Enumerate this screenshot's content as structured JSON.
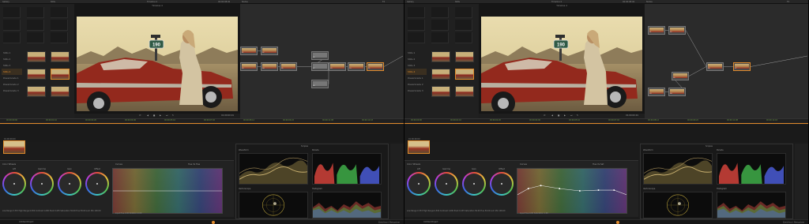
{
  "panes": [
    {
      "id": "left",
      "topbar": {
        "gallery": "Gallery",
        "stills": "Stills",
        "timeline": "Timeline 4",
        "timecode": "00:00:08:00",
        "nodes": "Nodes",
        "fx": "FX"
      },
      "albums": [
        "Stills 1",
        "Stills 2",
        "Stills 3",
        "Stills 4",
        "PowerGrade 1",
        "PowerGrade 2",
        "PowerGrade 3"
      ],
      "viewer": {
        "title": "Timeline 4",
        "timecode": "01:00:00:01",
        "sign": "190"
      },
      "nodes": [
        {
          "label": "01"
        },
        {
          "label": "02"
        },
        {
          "label": "03"
        },
        {
          "label": "04"
        },
        {
          "label": "05"
        },
        {
          "label": "06"
        },
        {
          "label": "07"
        },
        {
          "label": "08"
        },
        {
          "label": "09"
        },
        {
          "label": "10"
        },
        {
          "label": "11"
        }
      ],
      "timeline_marks": [
        "00:00:00:00",
        "00:00:01:10",
        "00:00:02:20",
        "00:00:04:06",
        "00:00:05:16",
        "00:00:07:02",
        "00:00:08:12",
        "00:00:09:22",
        "00:00:11:08",
        "00:00:12:18"
      ],
      "clip": {
        "timecode": "01:00:00:00"
      },
      "color": {
        "title": "Color Wheels",
        "wheels": [
          "Lift",
          "Gamma",
          "Gain",
          "Offset"
        ],
        "values": "Low Range 0.333   High Range 0.500   Contrast 1.000   Pivot 0.435   Saturation 50.00   Hue 50.00   Lum Mix 100.00",
        "curves_title": "Curves",
        "curves_mode": "Hue Vs Hue",
        "curves_footer": "Input Hue 0.00   Rotation 0.00",
        "curve": "flat"
      },
      "scopes": {
        "title": "Scopes",
        "waveform": "Waveform",
        "parade": "Parade",
        "vectorscope": "Vectorscope",
        "histogram": "Histogram"
      },
      "footer": {
        "project": "Untitled Project",
        "brand": "DaVinci Resolve"
      }
    },
    {
      "id": "right",
      "topbar": {
        "gallery": "Gallery",
        "stills": "Stills",
        "timeline": "Timeline 4",
        "timecode": "00:00:08:00",
        "nodes": "Nodes",
        "fx": "FX"
      },
      "albums": [
        "Stills 1",
        "Stills 2",
        "Stills 3",
        "Stills 4",
        "PowerGrade 1",
        "PowerGrade 2",
        "PowerGrade 3"
      ],
      "viewer": {
        "title": "Timeline 4",
        "timecode": "01:00:00:01",
        "sign": "190"
      },
      "nodes": [
        {
          "label": "01"
        },
        {
          "label": "02"
        },
        {
          "label": "03"
        },
        {
          "label": "04"
        },
        {
          "label": "05"
        },
        {
          "label": "06"
        },
        {
          "label": "07"
        }
      ],
      "timeline_marks": [
        "00:00:00:00",
        "00:00:01:10",
        "00:00:02:20",
        "00:00:04:06",
        "00:00:05:16",
        "00:00:07:02",
        "00:00:08:12",
        "00:00:09:22",
        "00:00:11:08",
        "00:00:12:18"
      ],
      "clip": {
        "timecode": "01:00:00:00"
      },
      "color": {
        "title": "Color Wheels",
        "wheels": [
          "Lift",
          "Gamma",
          "Gain",
          "Offset"
        ],
        "values": "Low Range 0.333   High Range 0.500   Contrast 1.000   Pivot 0.435   Saturation 50.00   Hue 50.00   Lum Mix 100.00",
        "curves_title": "Curves",
        "curves_mode": "Hue Vs Sat",
        "curves_footer": "Input Hue 0.00   Saturation 1.00",
        "curve": "bumped"
      },
      "scopes": {
        "title": "Scopes",
        "waveform": "Waveform",
        "parade": "Parade",
        "vectorscope": "Vectorscope",
        "histogram": "Histogram"
      },
      "footer": {
        "project": "Untitled Project",
        "brand": "DaVinci Resolve"
      }
    }
  ],
  "colors": {
    "accent": "#e08a2c",
    "panel": "#1b1b1b",
    "node_bg": "#2b2b2b"
  }
}
